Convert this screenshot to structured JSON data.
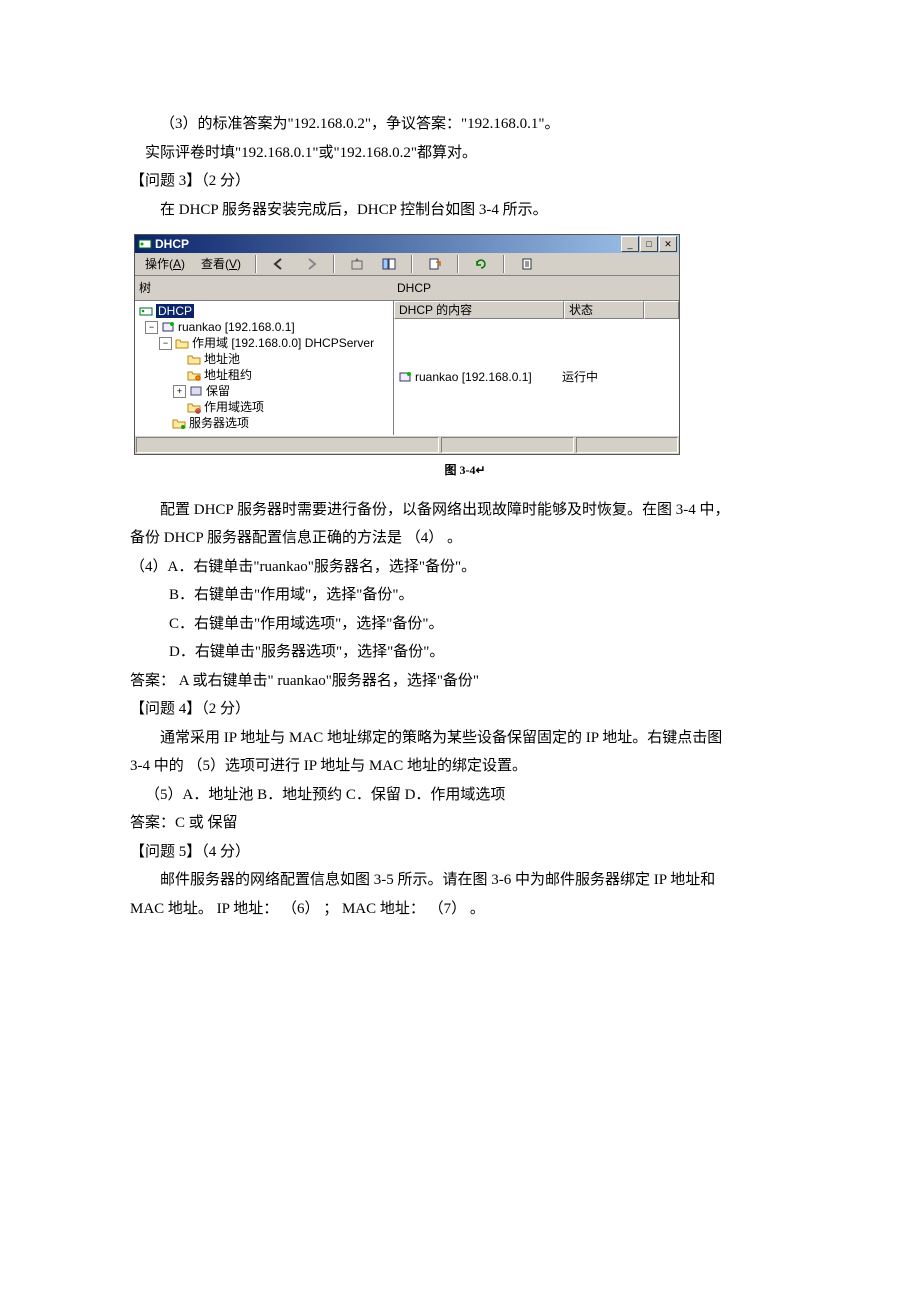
{
  "text": {
    "line3": "（3）的标准答案为\"192.168.0.2\"，争议答案：\"192.168.0.1\"。",
    "line3b": "实际评卷时填\"192.168.0.1\"或\"192.168.0.2\"都算对。",
    "q3_head": "【问题 3】（2 分）",
    "q3_body": "在 DHCP 服务器安装完成后，DHCP 控制台如图 3-4 所示。",
    "figcap": "图 3-4",
    "p_after_fig_1": "配置 DHCP 服务器时需要进行备份，以备网络出现故障时能够及时恢复。在图 3-4 中，",
    "p_after_fig_2": "备份 DHCP 服务器配置信息正确的方法是 （4） 。",
    "opt4_lead": "（4）A．右键单击\"ruankao\"服务器名，选择\"备份\"。",
    "opt4_b": "B．右键单击\"作用域\"，选择\"备份\"。",
    "opt4_c": "C．右键单击\"作用域选项\"，选择\"备份\"。",
    "opt4_d": "D．右键单击\"服务器选项\"，选择\"备份\"。",
    "ans4": "答案：  A  或右键单击\" ruankao\"服务器名，选择\"备份\"",
    "q4_head": "【问题 4】（2 分）",
    "q4_body1": "通常采用 IP 地址与 MAC 地址绑定的策略为某些设备保留固定的 IP 地址。右键点击图",
    "q4_body2": "3-4 中的 （5）选项可进行 IP 地址与 MAC 地址的绑定设置。",
    "opt5": "（5）A．地址池           B．地址预约                 C．保留              D．作用域选项",
    "ans5": "答案：C 或 保留",
    "q5_head": "【问题 5】（4 分）",
    "q5_body1": "邮件服务器的网络配置信息如图 3-5 所示。请在图 3-6 中为邮件服务器绑定 IP 地址和",
    "q5_body2": "MAC 地址。   IP 地址：   （6） ；   MAC 地址： （7） 。"
  },
  "dhcp": {
    "title": "DHCP",
    "menu_action_pre": "操作(",
    "menu_action_u": "A",
    "menu_action_post": ")",
    "menu_view_pre": "查看(",
    "menu_view_u": "V",
    "menu_view_post": ")",
    "left_tree_root": "树",
    "root_sel": "DHCP",
    "srv": "ruankao [192.168.0.1]",
    "scope": "作用域 [192.168.0.0] DHCPServer",
    "pool": "地址池",
    "lease": "地址租约",
    "reserve": "保留",
    "scopeopt": "作用域选项",
    "srvopt": "服务器选项",
    "rp_title": "DHCP",
    "col_content": "DHCP 的内容",
    "col_state": "状态",
    "row_srv": "ruankao [192.168.0.1]",
    "row_state": "运行中"
  }
}
